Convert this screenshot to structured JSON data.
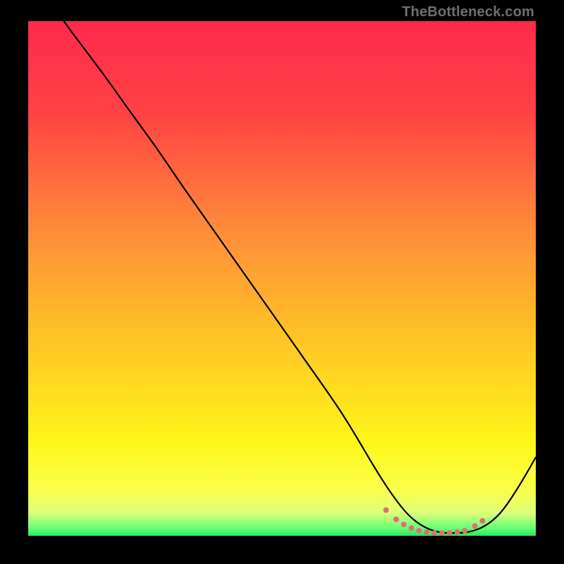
{
  "watermark": "TheBottleneck.com",
  "gradient": {
    "stops": [
      {
        "offset": 0.0,
        "color": "#ff2a4d"
      },
      {
        "offset": 0.18,
        "color": "#ff4244"
      },
      {
        "offset": 0.4,
        "color": "#ff8a3a"
      },
      {
        "offset": 0.62,
        "color": "#ffc526"
      },
      {
        "offset": 0.82,
        "color": "#fff61a"
      },
      {
        "offset": 0.91,
        "color": "#faff4a"
      },
      {
        "offset": 0.955,
        "color": "#dfff7a"
      },
      {
        "offset": 0.985,
        "color": "#67ff77"
      },
      {
        "offset": 1.0,
        "color": "#29e85a"
      }
    ]
  },
  "chart_data": {
    "type": "line",
    "title": "",
    "xlabel": "",
    "ylabel": "",
    "xlim": [
      0,
      100
    ],
    "ylim": [
      0,
      100
    ],
    "series": [
      {
        "name": "bottleneck-curve",
        "x": [
          7,
          10,
          15,
          20,
          25,
          30,
          35,
          40,
          45,
          50,
          55,
          60,
          63,
          66,
          69,
          72,
          75,
          78,
          81,
          84,
          87,
          90,
          93,
          96,
          99,
          100
        ],
        "y": [
          100,
          96,
          89.5,
          82.5,
          75.8,
          68.5,
          61.5,
          54.5,
          47.5,
          40.5,
          33.5,
          26.5,
          22,
          17,
          12,
          7.5,
          3.8,
          1.6,
          0.6,
          0.5,
          0.7,
          1.8,
          4.2,
          8.5,
          13.5,
          15.3
        ]
      }
    ],
    "markers": {
      "name": "trough-dots",
      "color": "#e07070",
      "x": [
        70.5,
        72.5,
        74,
        75.5,
        77,
        78.5,
        80,
        81.5,
        83,
        84.5,
        86,
        88,
        89.5
      ],
      "y": [
        5.0,
        3.2,
        2.2,
        1.5,
        1.0,
        0.7,
        0.55,
        0.5,
        0.55,
        0.7,
        1.0,
        1.9,
        2.9
      ]
    }
  }
}
